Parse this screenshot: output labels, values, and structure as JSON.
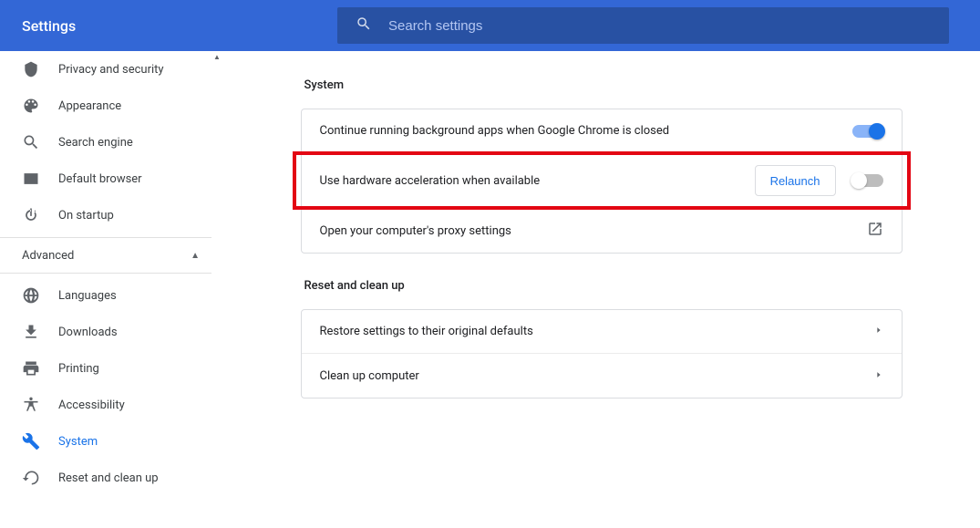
{
  "header": {
    "title": "Settings",
    "search_placeholder": "Search settings"
  },
  "sidebar": {
    "top": [
      {
        "label": "Privacy and security"
      },
      {
        "label": "Appearance"
      },
      {
        "label": "Search engine"
      },
      {
        "label": "Default browser"
      },
      {
        "label": "On startup"
      }
    ],
    "advanced_label": "Advanced",
    "advanced": [
      {
        "label": "Languages"
      },
      {
        "label": "Downloads"
      },
      {
        "label": "Printing"
      },
      {
        "label": "Accessibility"
      },
      {
        "label": "System"
      },
      {
        "label": "Reset and clean up"
      }
    ]
  },
  "sections": {
    "system": {
      "title": "System",
      "rows": {
        "bgapps": "Continue running background apps when Google Chrome is closed",
        "hwaccel": "Use hardware acceleration when available",
        "relaunch": "Relaunch",
        "proxy": "Open your computer's proxy settings"
      }
    },
    "reset": {
      "title": "Reset and clean up",
      "rows": {
        "restore": "Restore settings to their original defaults",
        "cleanup": "Clean up computer"
      }
    }
  }
}
